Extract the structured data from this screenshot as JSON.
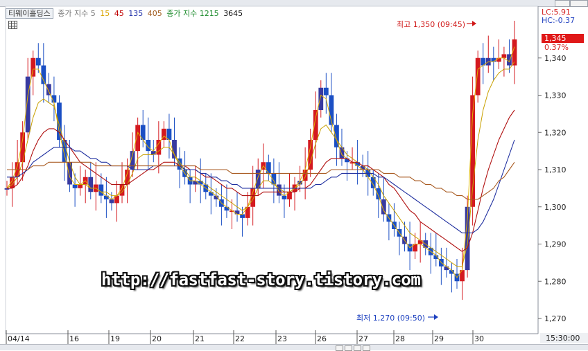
{
  "legend": {
    "name": "티웨이홀딩스",
    "ma_label": "종가 지수 5",
    "ma_periods": [
      {
        "value": "15",
        "color": "#d9a400"
      },
      {
        "value": "45",
        "color": "#c00000"
      },
      {
        "value": "135",
        "color": "#1f2fa8"
      },
      {
        "value": "405",
        "color": "#a05a1c"
      }
    ],
    "ma2_label": "종가 지수 1215",
    "ma2_color": "#1a8a2a",
    "ma2_extra": "3645"
  },
  "right_panel": {
    "lc": "LC:5.91",
    "hc": "HC:-0.37",
    "current_price": "1,345",
    "current_change": "0.37%",
    "time": "15:30:00"
  },
  "annotations": {
    "high": "최고 1,350 (09:45)",
    "low": "최저 1,270 (09:50)"
  },
  "watermark": "http://fastfast-story.tistory.com",
  "colors": {
    "up": "#d4191f",
    "down": "#1b4fc4",
    "navy": "#383aa0",
    "ma5": "#e0b000",
    "ma15": "#c8a000",
    "ma45": "#b01010",
    "ma135": "#2030a0",
    "ma405": "#a85a20"
  },
  "chart_data": {
    "type": "line",
    "title": "티웨이홀딩스",
    "x_tick_labels": [
      "04/14",
      "16",
      "19",
      "20",
      "21",
      "22",
      "23",
      "26",
      "27",
      "28",
      "29",
      "30"
    ],
    "ylim": [
      1265,
      1355
    ],
    "y_ticks": [
      1270,
      1280,
      1290,
      1300,
      1310,
      1320,
      1330,
      1340
    ],
    "y_tick_labels": [
      "1,270",
      "1,280",
      "1,290",
      "1,300",
      "1,310",
      "1,320",
      "1,330",
      "1,340"
    ],
    "high": {
      "value": 1350,
      "time": "09:45"
    },
    "low": {
      "value": 1270,
      "time": "09:50"
    },
    "last_price": 1345,
    "price_series_approx": [
      1305,
      1308,
      1312,
      1320,
      1335,
      1340,
      1338,
      1333,
      1330,
      1328,
      1318,
      1312,
      1306,
      1305,
      1306,
      1308,
      1304,
      1306,
      1303,
      1302,
      1301,
      1303,
      1306,
      1310,
      1315,
      1322,
      1318,
      1315,
      1314,
      1318,
      1321,
      1318,
      1313,
      1310,
      1308,
      1306,
      1307,
      1306,
      1304,
      1303,
      1302,
      1300,
      1299,
      1299,
      1298,
      1297,
      1300,
      1305,
      1310,
      1312,
      1309,
      1306,
      1303,
      1302,
      1304,
      1306,
      1307,
      1310,
      1318,
      1326,
      1332,
      1330,
      1322,
      1316,
      1313,
      1312,
      1312,
      1311,
      1310,
      1308,
      1305,
      1302,
      1298,
      1296,
      1294,
      1292,
      1290,
      1288,
      1290,
      1291,
      1289,
      1287,
      1286,
      1284,
      1283,
      1282,
      1280,
      1283,
      1300,
      1330,
      1340,
      1338,
      1340,
      1339,
      1340,
      1341,
      1338,
      1345
    ],
    "series": [
      {
        "name": "5",
        "values": [
          1305,
          1307,
          1311,
          1318,
          1330,
          1337,
          1337,
          1334,
          1331,
          1328,
          1320,
          1314,
          1308,
          1306,
          1306,
          1307,
          1305,
          1305,
          1304,
          1303,
          1302,
          1303,
          1305,
          1309,
          1314,
          1320,
          1318,
          1316,
          1315,
          1317,
          1319,
          1318,
          1314,
          1311,
          1309,
          1307,
          1307,
          1306,
          1305,
          1304,
          1303,
          1301,
          1300,
          1299,
          1298,
          1298,
          1300,
          1304,
          1308,
          1311,
          1309,
          1307,
          1304,
          1303,
          1304,
          1305,
          1307,
          1310,
          1316,
          1324,
          1330,
          1329,
          1323,
          1318,
          1314,
          1313,
          1312,
          1311,
          1310,
          1308,
          1306,
          1303,
          1299,
          1297,
          1295,
          1293,
          1291,
          1289,
          1290,
          1290,
          1289,
          1288,
          1287,
          1285,
          1284,
          1283,
          1281,
          1283,
          1297,
          1325,
          1337,
          1338,
          1339,
          1339,
          1340,
          1340,
          1339,
          1343
        ]
      },
      {
        "name": "15",
        "values": [
          1305,
          1306,
          1308,
          1312,
          1318,
          1324,
          1328,
          1329,
          1328,
          1327,
          1322,
          1317,
          1312,
          1308,
          1306,
          1306,
          1305,
          1305,
          1304,
          1304,
          1303,
          1303,
          1304,
          1306,
          1309,
          1313,
          1314,
          1314,
          1314,
          1315,
          1316,
          1316,
          1314,
          1312,
          1310,
          1308,
          1308,
          1307,
          1306,
          1305,
          1304,
          1303,
          1302,
          1301,
          1300,
          1299,
          1300,
          1302,
          1305,
          1307,
          1307,
          1306,
          1305,
          1304,
          1304,
          1305,
          1306,
          1308,
          1312,
          1317,
          1321,
          1322,
          1320,
          1318,
          1316,
          1314,
          1313,
          1312,
          1311,
          1310,
          1308,
          1306,
          1303,
          1301,
          1299,
          1297,
          1295,
          1293,
          1292,
          1291,
          1290,
          1289,
          1288,
          1287,
          1286,
          1285,
          1284,
          1284,
          1290,
          1305,
          1318,
          1326,
          1331,
          1334,
          1336,
          1337,
          1337,
          1339
        ]
      },
      {
        "name": "45",
        "values": [
          1305,
          1305,
          1306,
          1308,
          1311,
          1315,
          1318,
          1320,
          1321,
          1321,
          1320,
          1318,
          1316,
          1314,
          1312,
          1311,
          1310,
          1309,
          1308,
          1307,
          1306,
          1306,
          1306,
          1306,
          1307,
          1308,
          1309,
          1310,
          1310,
          1311,
          1312,
          1312,
          1312,
          1311,
          1311,
          1310,
          1310,
          1309,
          1308,
          1308,
          1307,
          1306,
          1305,
          1305,
          1304,
          1303,
          1303,
          1303,
          1303,
          1304,
          1304,
          1304,
          1304,
          1304,
          1304,
          1304,
          1305,
          1305,
          1306,
          1308,
          1310,
          1312,
          1313,
          1313,
          1313,
          1313,
          1312,
          1312,
          1311,
          1311,
          1310,
          1309,
          1308,
          1306,
          1305,
          1303,
          1301,
          1299,
          1298,
          1296,
          1295,
          1294,
          1293,
          1292,
          1291,
          1290,
          1289,
          1288,
          1289,
          1293,
          1299,
          1305,
          1310,
          1314,
          1318,
          1321,
          1324,
          1326
        ]
      },
      {
        "name": "135",
        "values": [
          1308,
          1308,
          1308,
          1309,
          1310,
          1312,
          1313,
          1314,
          1315,
          1316,
          1316,
          1316,
          1316,
          1315,
          1315,
          1314,
          1313,
          1313,
          1312,
          1312,
          1311,
          1311,
          1311,
          1311,
          1310,
          1310,
          1310,
          1310,
          1311,
          1311,
          1311,
          1311,
          1311,
          1311,
          1310,
          1310,
          1310,
          1309,
          1309,
          1308,
          1308,
          1307,
          1307,
          1306,
          1306,
          1305,
          1305,
          1305,
          1305,
          1305,
          1305,
          1305,
          1305,
          1305,
          1305,
          1305,
          1305,
          1305,
          1305,
          1306,
          1306,
          1307,
          1308,
          1308,
          1309,
          1309,
          1309,
          1309,
          1309,
          1309,
          1309,
          1308,
          1308,
          1307,
          1306,
          1305,
          1304,
          1303,
          1302,
          1301,
          1300,
          1299,
          1298,
          1297,
          1296,
          1295,
          1294,
          1293,
          1293,
          1293,
          1294,
          1296,
          1299,
          1302,
          1306,
          1310,
          1314,
          1318
        ]
      },
      {
        "name": "405",
        "values": [
          1310,
          1310,
          1310,
          1310,
          1310,
          1311,
          1311,
          1311,
          1312,
          1312,
          1312,
          1312,
          1312,
          1312,
          1312,
          1312,
          1312,
          1311,
          1311,
          1311,
          1311,
          1311,
          1311,
          1311,
          1311,
          1311,
          1311,
          1311,
          1311,
          1311,
          1311,
          1311,
          1311,
          1311,
          1311,
          1311,
          1311,
          1310,
          1310,
          1310,
          1310,
          1310,
          1310,
          1309,
          1309,
          1309,
          1309,
          1309,
          1309,
          1309,
          1309,
          1309,
          1309,
          1309,
          1309,
          1309,
          1309,
          1309,
          1309,
          1309,
          1309,
          1309,
          1310,
          1310,
          1310,
          1310,
          1310,
          1310,
          1310,
          1310,
          1310,
          1310,
          1309,
          1309,
          1309,
          1308,
          1308,
          1308,
          1307,
          1307,
          1306,
          1306,
          1305,
          1305,
          1304,
          1304,
          1303,
          1303,
          1302,
          1302,
          1302,
          1303,
          1304,
          1305,
          1307,
          1308,
          1310,
          1312
        ]
      }
    ],
    "grid": false,
    "legend_position": "top-left"
  }
}
